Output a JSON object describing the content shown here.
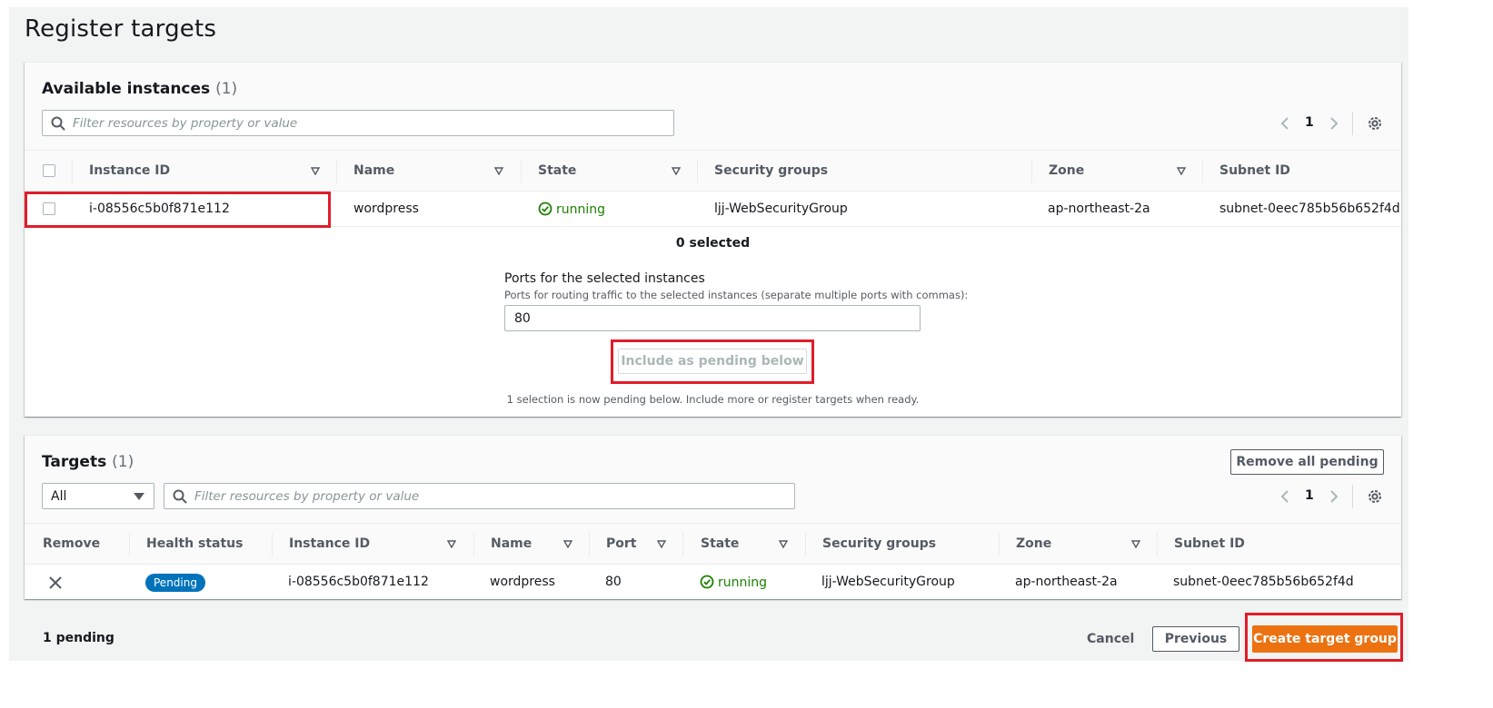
{
  "page": {
    "title": "Register targets"
  },
  "available": {
    "title": "Available instances",
    "count": "(1)",
    "filter_placeholder": "Filter resources by property or value",
    "page_number": "1",
    "columns": [
      "Instance ID",
      "Name",
      "State",
      "Security groups",
      "Zone",
      "Subnet ID"
    ],
    "rows": [
      {
        "instance_id": "i-08556c5b0f871e112",
        "name": "wordpress",
        "state": "running",
        "security_groups": "ljj-WebSecurityGroup",
        "zone": "ap-northeast-2a",
        "subnet_id": "subnet-0eec785b56b652f4d"
      }
    ],
    "selected_text": "0 selected",
    "ports_label": "Ports for the selected instances",
    "ports_hint": "Ports for routing traffic to the selected instances (separate multiple ports with commas):",
    "ports_value": "80",
    "include_button": "Include as pending below",
    "pending_note": "1 selection is now pending below. Include more or register targets when ready."
  },
  "targets": {
    "title": "Targets",
    "count": "(1)",
    "remove_all_button": "Remove all pending",
    "filter_select_value": "All",
    "filter_placeholder": "Filter resources by property or value",
    "page_number": "1",
    "columns": [
      "Remove",
      "Health status",
      "Instance ID",
      "Name",
      "Port",
      "State",
      "Security groups",
      "Zone",
      "Subnet ID"
    ],
    "rows": [
      {
        "health_status": "Pending",
        "instance_id": "i-08556c5b0f871e112",
        "name": "wordpress",
        "port": "80",
        "state": "running",
        "security_groups": "ljj-WebSecurityGroup",
        "zone": "ap-northeast-2a",
        "subnet_id": "subnet-0eec785b56b652f4d"
      }
    ]
  },
  "footer": {
    "pending_count": "1 pending",
    "cancel": "Cancel",
    "previous": "Previous",
    "create": "Create target group"
  },
  "colors": {
    "accent": "#ec7211",
    "running": "#1d8102",
    "badge": "#0073bb",
    "highlight": "#e11d2a"
  },
  "icons": [
    "search-icon",
    "chevron-left-icon",
    "chevron-right-icon",
    "gear-icon",
    "sort-icon",
    "check-circle-icon",
    "close-icon",
    "caret-down-icon"
  ]
}
